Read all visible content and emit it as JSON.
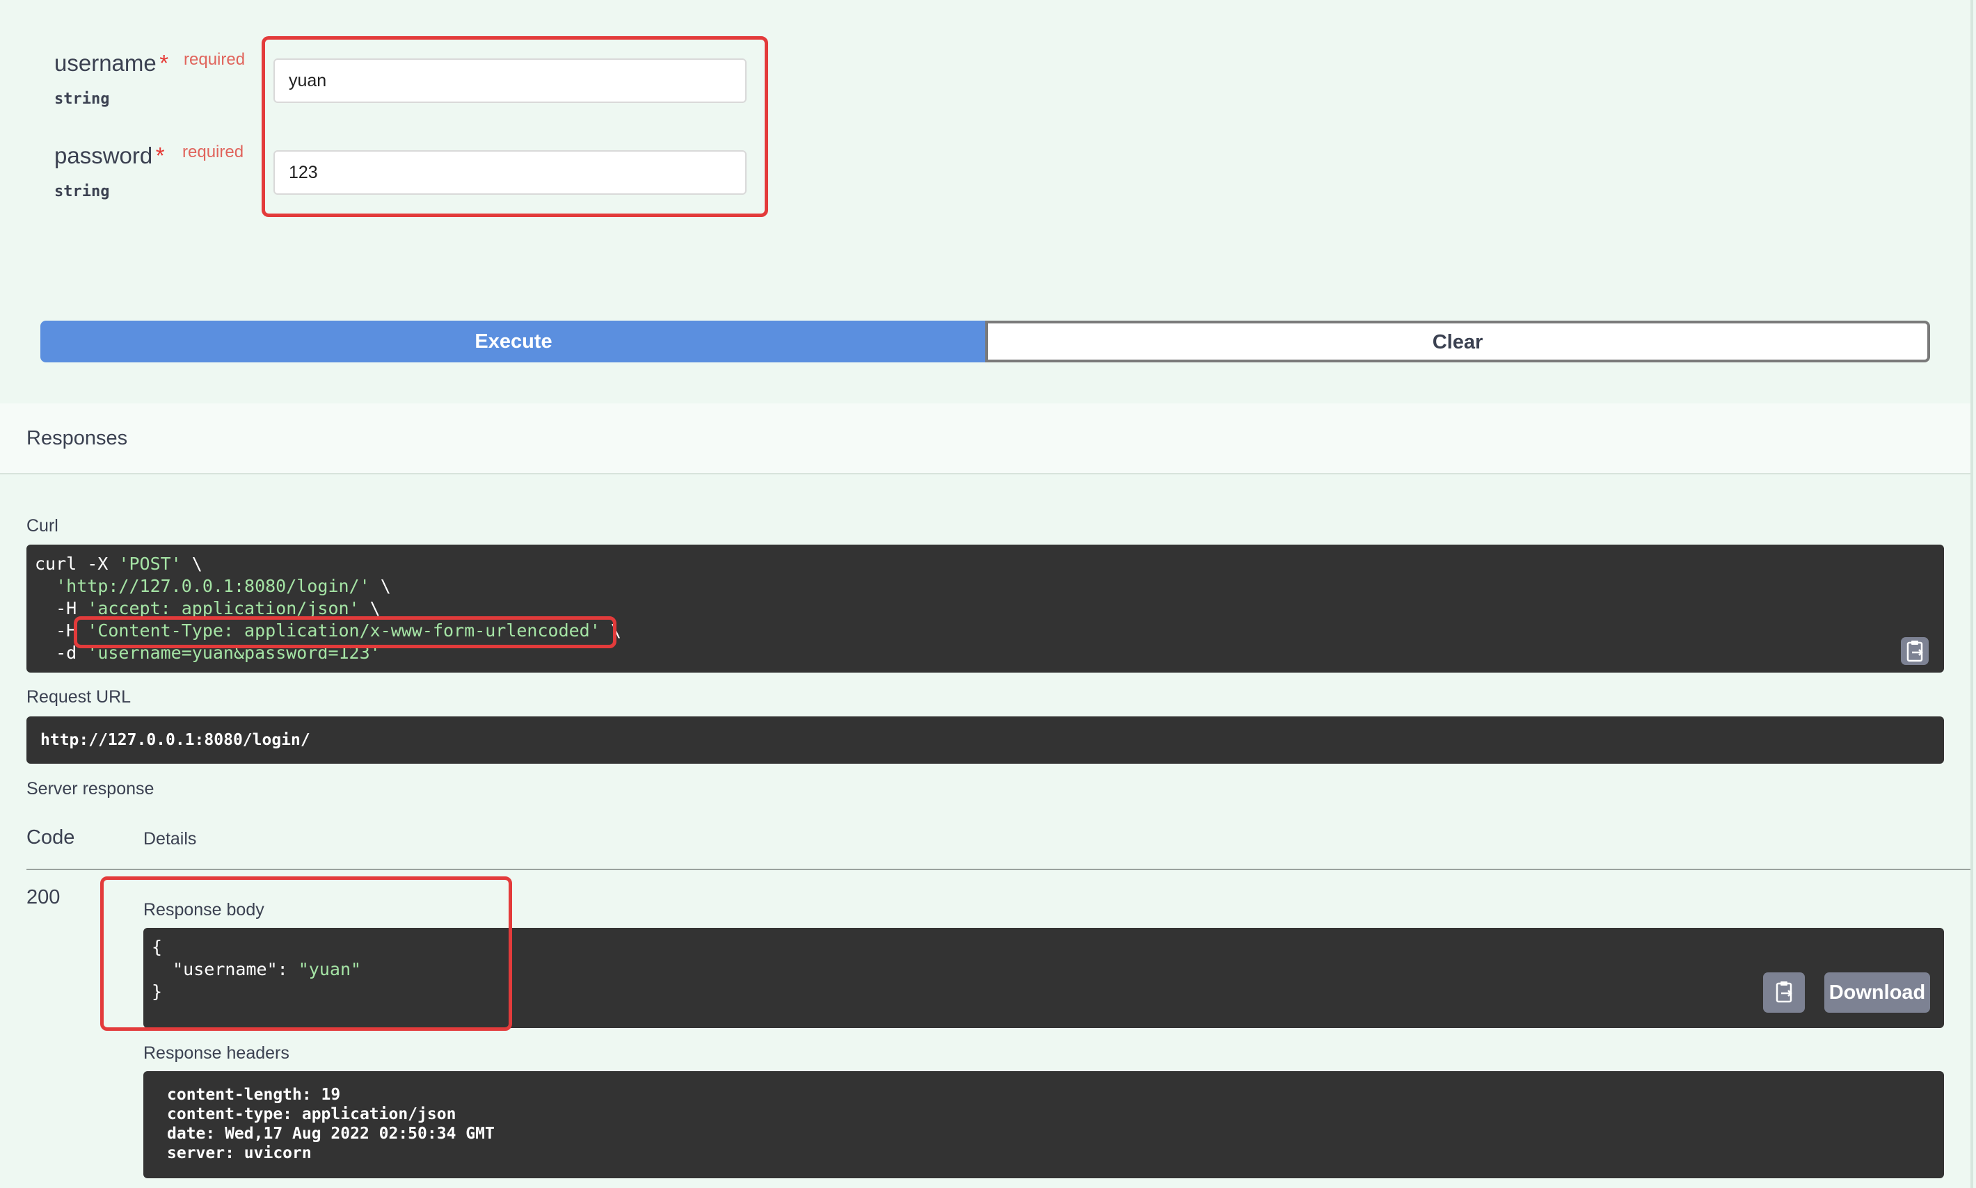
{
  "params": [
    {
      "name": "username",
      "required_star": "*",
      "required_label": "required",
      "type": "string",
      "value": "yuan"
    },
    {
      "name": "password",
      "required_star": "*",
      "required_label": "required",
      "type": "string",
      "value": "123"
    }
  ],
  "buttons": {
    "execute": "Execute",
    "clear": "Clear"
  },
  "responses": {
    "title": "Responses",
    "curl_label": "Curl",
    "curl_lines": [
      {
        "prefix": "curl -X ",
        "str": "'POST'",
        "suffix": " \\"
      },
      {
        "prefix": "  ",
        "str": "'http://127.0.0.1:8080/login/'",
        "suffix": " \\"
      },
      {
        "prefix": "  -H ",
        "str": "'accept: application/json'",
        "suffix": " \\"
      },
      {
        "prefix": "  -H ",
        "str": "'Content-Type: application/x-www-form-urlencoded'",
        "suffix": " \\"
      },
      {
        "prefix": "  -d ",
        "str": "'username=yuan&password=123'",
        "suffix": ""
      }
    ],
    "request_url_label": "Request URL",
    "request_url": "http://127.0.0.1:8080/login/",
    "server_response_label": "Server response",
    "table_headers": {
      "code": "Code",
      "details": "Details"
    },
    "code": "200",
    "response_body_label": "Response body",
    "body_lines": [
      {
        "text": "{",
        "key": "",
        "sep": "",
        "str": ""
      },
      {
        "text": "  ",
        "key": "\"username\"",
        "sep": ": ",
        "str": "\"yuan\""
      },
      {
        "text": "}",
        "key": "",
        "sep": "",
        "str": ""
      }
    ],
    "download_label": "Download",
    "response_headers_label": "Response headers",
    "headers": [
      "content-length: 19",
      "content-type: application/json",
      "date: Wed,17 Aug 2022 02:50:34 GMT",
      "server: uvicorn"
    ]
  },
  "icons": {
    "copy": "clipboard-icon"
  },
  "colors": {
    "execute": "#5b8fdf",
    "highlight": "#e33b3b",
    "code_bg": "#333333",
    "string": "#a5e4a5"
  }
}
